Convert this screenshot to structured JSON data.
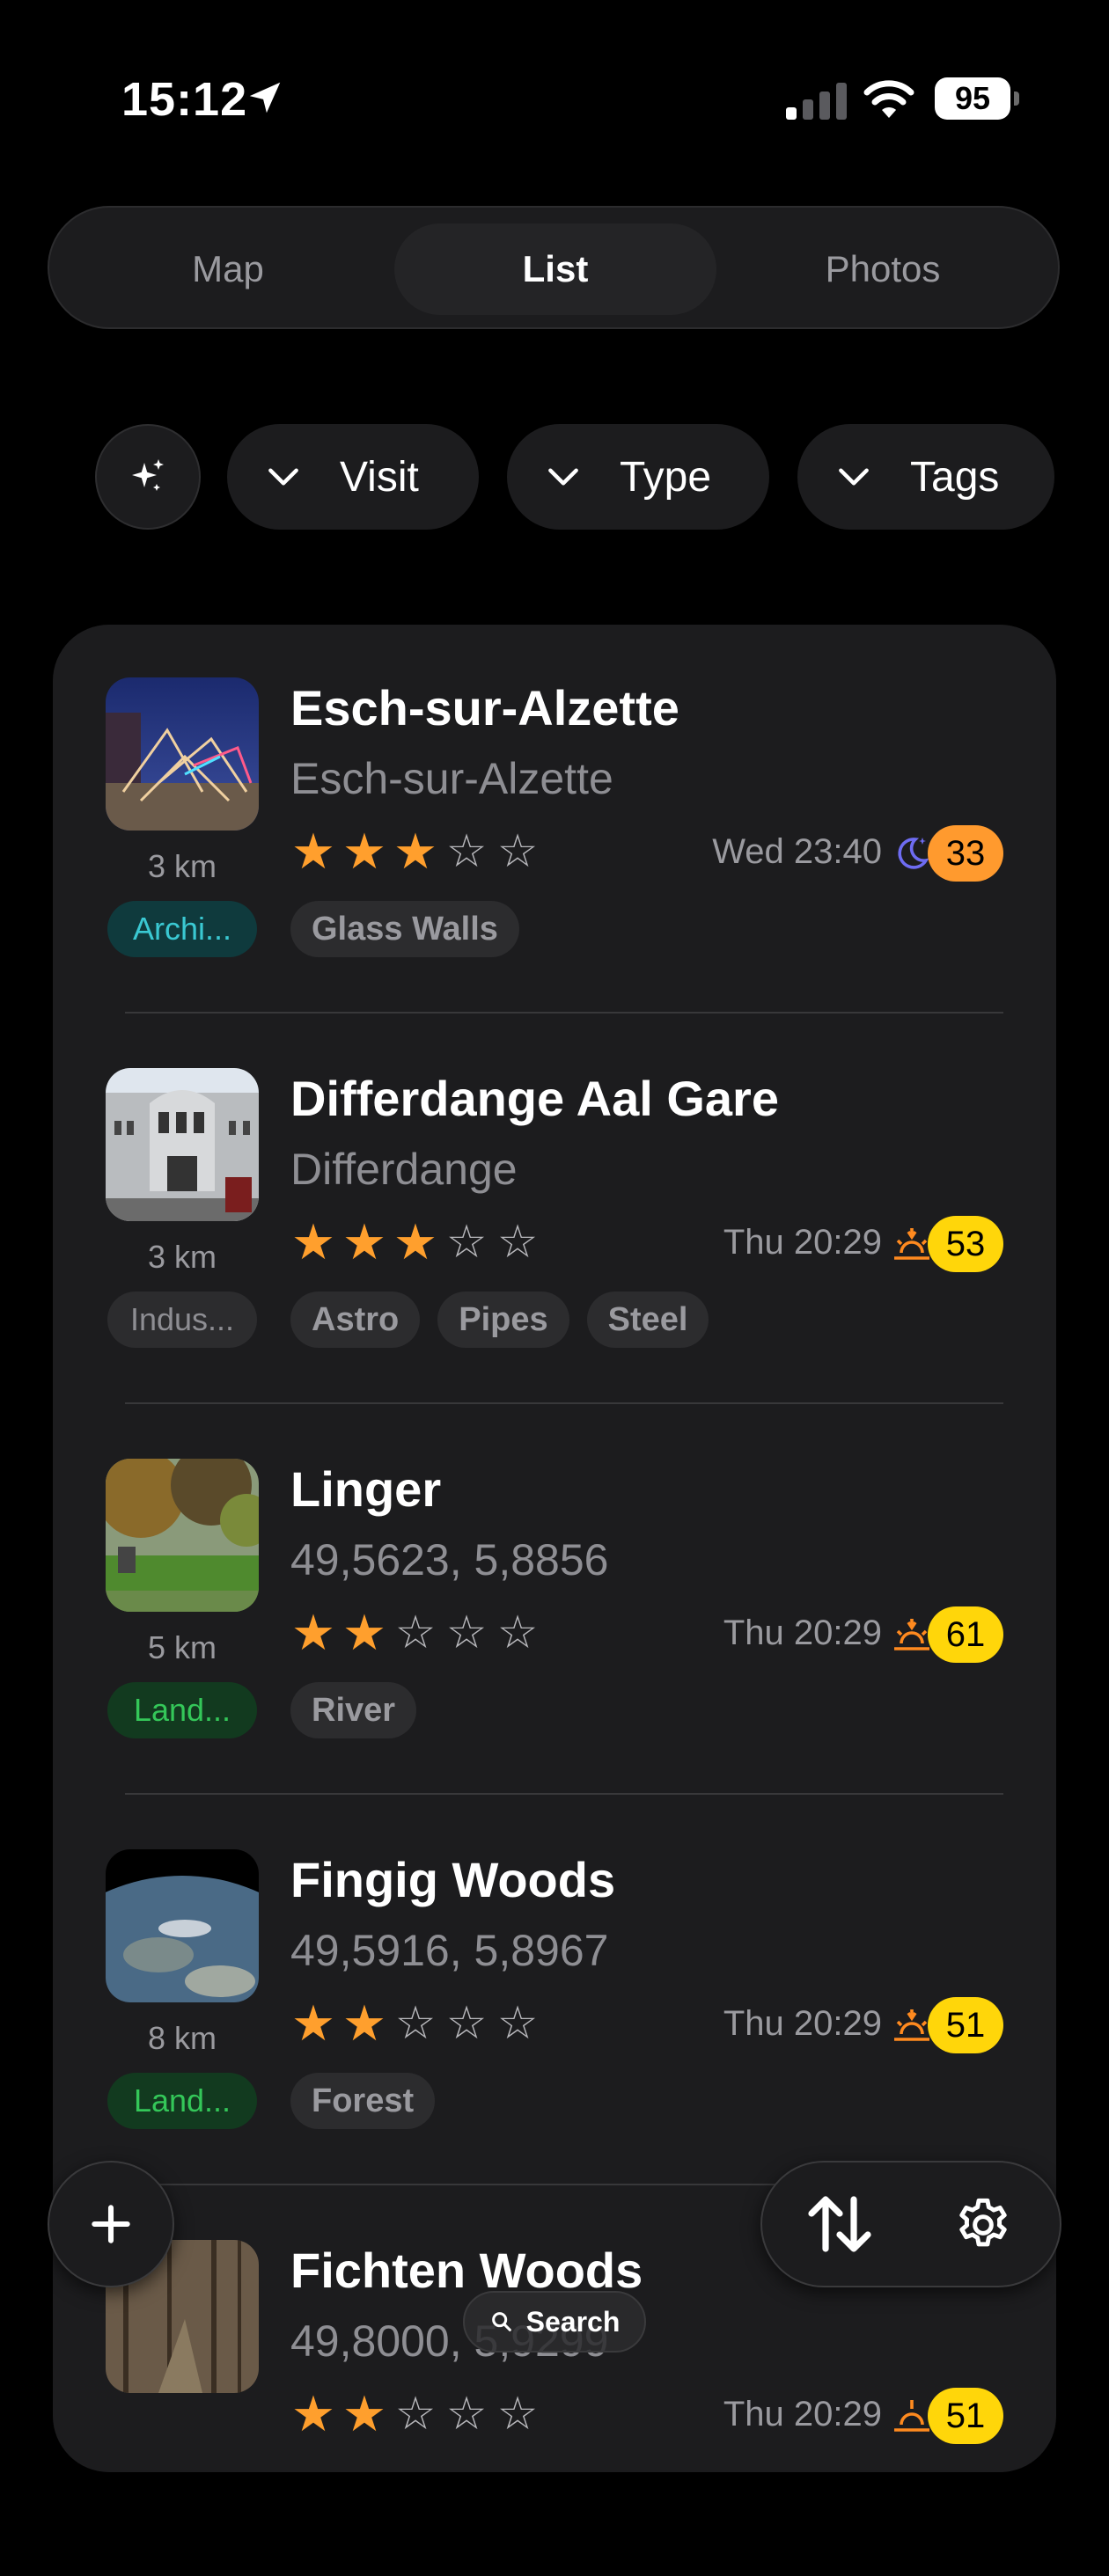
{
  "status": {
    "time": "15:12",
    "battery": "95"
  },
  "tabs": [
    {
      "label": "Map"
    },
    {
      "label": "List"
    },
    {
      "label": "Photos"
    }
  ],
  "filters": [
    {
      "label": "Visit"
    },
    {
      "label": "Type"
    },
    {
      "label": "Tags"
    }
  ],
  "places": [
    {
      "title": "Esch-sur-Alzette",
      "subtitle": "Esch-sur-Alzette",
      "rating": 3,
      "distance": "3 km",
      "category": "Archi...",
      "when": "Wed 23:40",
      "when_icon": "moon-icon",
      "score": "33",
      "score_color": "#ff9a2e",
      "tags": [
        "Glass Walls"
      ]
    },
    {
      "title": "Differdange Aal Gare",
      "subtitle": "Differdange",
      "rating": 3,
      "distance": "3 km",
      "category": "Indus...",
      "when": "Thu 20:29",
      "when_icon": "sunset-icon",
      "score": "53",
      "score_color": "#ffd60a",
      "tags": [
        "Astro",
        "Pipes",
        "Steel"
      ]
    },
    {
      "title": "Linger",
      "subtitle": "49,5623, 5,8856",
      "rating": 2,
      "distance": "5 km",
      "category": "Land...",
      "when": "Thu 20:29",
      "when_icon": "sunset-icon",
      "score": "61",
      "score_color": "#ffd60a",
      "tags": [
        "River"
      ]
    },
    {
      "title": "Fingig Woods",
      "subtitle": "49,5916, 5,8967",
      "rating": 2,
      "distance": "8 km",
      "category": "Land...",
      "when": "Thu 20:29",
      "when_icon": "sunset-icon",
      "score": "51",
      "score_color": "#ffd60a",
      "tags": [
        "Forest"
      ]
    },
    {
      "title": "Fichten Woods",
      "subtitle": "49,8000, 5,9299",
      "rating": 2,
      "when": "Thu 20:29",
      "score": "51"
    }
  ],
  "search": {
    "label": "Search"
  },
  "colors": {
    "accent_star": "#ff9f2d",
    "teal_chip": "#3ac8d2",
    "green_chip": "#34c759"
  }
}
